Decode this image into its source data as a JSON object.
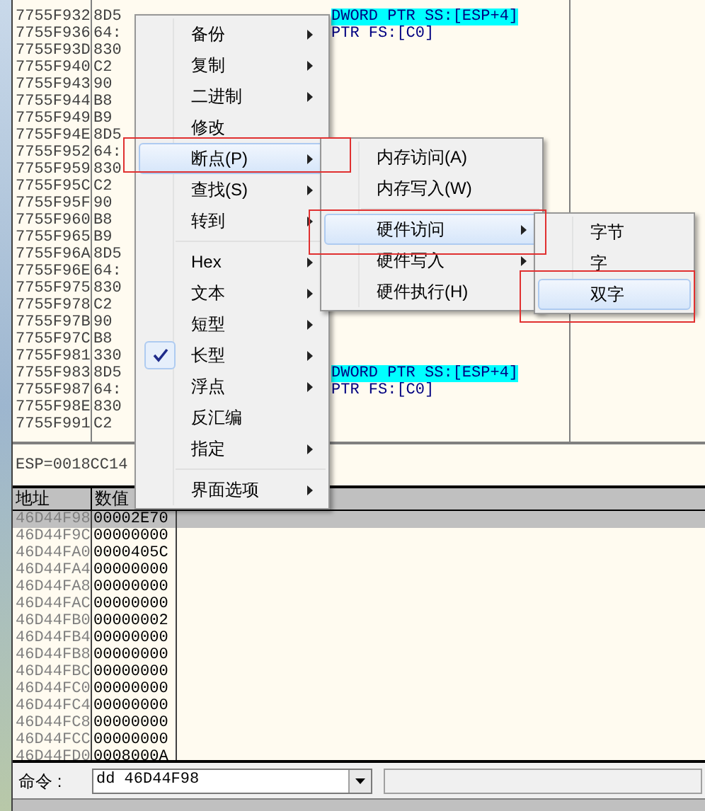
{
  "disassembly": {
    "rows": [
      {
        "address": "7755F932",
        "hex": "8D5",
        "code": "DWORD PTR SS:[ESP+4]",
        "highlight": true
      },
      {
        "address": "7755F936",
        "hex": "64:",
        "code": "PTR FS:[C0]",
        "highlight": false
      },
      {
        "address": "7755F93D",
        "hex": "830"
      },
      {
        "address": "7755F940",
        "hex": "C2"
      },
      {
        "address": "7755F943",
        "hex": "90"
      },
      {
        "address": "7755F944",
        "hex": "B8"
      },
      {
        "address": "7755F949",
        "hex": "B9"
      },
      {
        "address": "7755F94E",
        "hex": "8D5"
      },
      {
        "address": "7755F952",
        "hex": "64:"
      },
      {
        "address": "7755F959",
        "hex": "830"
      },
      {
        "address": "7755F95C",
        "hex": "C2"
      },
      {
        "address": "7755F95F",
        "hex": "90"
      },
      {
        "address": "7755F960",
        "hex": "B8"
      },
      {
        "address": "7755F965",
        "hex": "B9"
      },
      {
        "address": "7755F96A",
        "hex": "8D5"
      },
      {
        "address": "7755F96E",
        "hex": "64:"
      },
      {
        "address": "7755F975",
        "hex": "830"
      },
      {
        "address": "7755F978",
        "hex": "C2"
      },
      {
        "address": "7755F97B",
        "hex": "90"
      },
      {
        "address": "7755F97C",
        "hex": "B8"
      },
      {
        "address": "7755F981",
        "hex": "330"
      },
      {
        "address": "7755F983",
        "hex": "8D5",
        "code": "DWORD PTR SS:[ESP+4]",
        "highlight": true
      },
      {
        "address": "7755F987",
        "hex": "64:",
        "code": "PTR FS:[C0]",
        "highlight": false
      },
      {
        "address": "7755F98E",
        "hex": "830"
      },
      {
        "address": "7755F991",
        "hex": "C2"
      }
    ]
  },
  "info": "ESP=0018CC14",
  "stack": {
    "columns": [
      "地址",
      "数值"
    ],
    "rows": [
      {
        "address": "46D44F98",
        "value": "00002E70",
        "selected": true
      },
      {
        "address": "46D44F9C",
        "value": "00000000",
        "selected": false
      },
      {
        "address": "46D44FA0",
        "value": "0000405C",
        "selected": false
      },
      {
        "address": "46D44FA4",
        "value": "00000000",
        "selected": false
      },
      {
        "address": "46D44FA8",
        "value": "00000000",
        "selected": false
      },
      {
        "address": "46D44FAC",
        "value": "00000000",
        "selected": false
      },
      {
        "address": "46D44FB0",
        "value": "00000002",
        "selected": false
      },
      {
        "address": "46D44FB4",
        "value": "00000000",
        "selected": false
      },
      {
        "address": "46D44FB8",
        "value": "00000000",
        "selected": false
      },
      {
        "address": "46D44FBC",
        "value": "00000000",
        "selected": false
      },
      {
        "address": "46D44FC0",
        "value": "00000000",
        "selected": false
      },
      {
        "address": "46D44FC4",
        "value": "00000000",
        "selected": false
      },
      {
        "address": "46D44FC8",
        "value": "00000000",
        "selected": false
      },
      {
        "address": "46D44FCC",
        "value": "00000000",
        "selected": false
      },
      {
        "address": "46D44FD0",
        "value": "0008000A",
        "selected": false
      }
    ]
  },
  "command": {
    "label": "命令 :",
    "value": "dd 46D44F98"
  },
  "context_menu": {
    "items": [
      {
        "kind": "item",
        "label": "备份",
        "submenu": true,
        "selected": false,
        "checked": false
      },
      {
        "kind": "item",
        "label": "复制",
        "submenu": true,
        "selected": false,
        "checked": false
      },
      {
        "kind": "item",
        "label": "二进制",
        "submenu": true,
        "selected": false,
        "checked": false
      },
      {
        "kind": "item",
        "label": "修改",
        "submenu": false,
        "selected": false,
        "checked": false
      },
      {
        "kind": "item",
        "label": "断点(P)",
        "submenu": true,
        "selected": true,
        "checked": false
      },
      {
        "kind": "item",
        "label": "查找(S)",
        "submenu": true,
        "selected": false,
        "checked": false
      },
      {
        "kind": "item",
        "label": "转到",
        "submenu": true,
        "selected": false,
        "checked": false
      },
      {
        "kind": "separator"
      },
      {
        "kind": "item",
        "label": "Hex",
        "submenu": true,
        "selected": false,
        "checked": false
      },
      {
        "kind": "item",
        "label": "文本",
        "submenu": true,
        "selected": false,
        "checked": false
      },
      {
        "kind": "item",
        "label": "短型",
        "submenu": true,
        "selected": false,
        "checked": false
      },
      {
        "kind": "item",
        "label": "长型",
        "submenu": true,
        "selected": false,
        "checked": true
      },
      {
        "kind": "item",
        "label": "浮点",
        "submenu": true,
        "selected": false,
        "checked": false
      },
      {
        "kind": "item",
        "label": "反汇编",
        "submenu": false,
        "selected": false,
        "checked": false
      },
      {
        "kind": "item",
        "label": "指定",
        "submenu": true,
        "selected": false,
        "checked": false
      },
      {
        "kind": "separator"
      },
      {
        "kind": "item",
        "label": "界面选项",
        "submenu": true,
        "selected": false,
        "checked": false
      }
    ]
  },
  "breakpoint_menu": {
    "items": [
      {
        "kind": "item",
        "label": "内存访问(A)",
        "submenu": false,
        "selected": false
      },
      {
        "kind": "item",
        "label": "内存写入(W)",
        "submenu": false,
        "selected": false
      },
      {
        "kind": "separator"
      },
      {
        "kind": "item",
        "label": "硬件访问",
        "submenu": true,
        "selected": true
      },
      {
        "kind": "item",
        "label": "硬件写入",
        "submenu": true,
        "selected": false
      },
      {
        "kind": "item",
        "label": "硬件执行(H)",
        "submenu": false,
        "selected": false
      }
    ]
  },
  "hardware_access_menu": {
    "items": [
      {
        "kind": "item",
        "label": "字节",
        "submenu": false,
        "selected": false
      },
      {
        "kind": "item",
        "label": "字",
        "submenu": false,
        "selected": false
      },
      {
        "kind": "item",
        "label": "双字",
        "submenu": false,
        "selected": true
      }
    ]
  }
}
